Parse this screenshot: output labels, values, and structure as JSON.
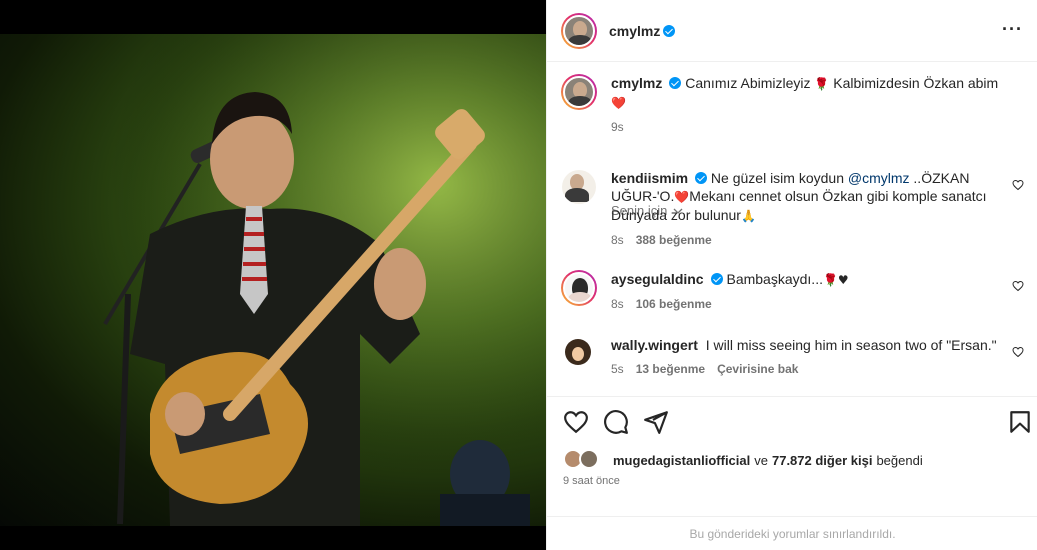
{
  "post": {
    "author": "cmylmz",
    "verified": true
  },
  "caption": {
    "username": "cmylmz",
    "text_before": "Canımız Abimizleyiz",
    "text_middle": "Kalbimizdesin Özkan abim",
    "time": "9s",
    "emoji_rose": "🌹",
    "emoji_heart": "❤️"
  },
  "sort": {
    "label": "Senin için"
  },
  "comments": [
    {
      "username": "kendiismim",
      "text_before": "Ne güzel isim koydun",
      "mention": "@cmylmz",
      "text_after": "..ÖZKAN UĞUR-'O.",
      "text_after2": "Mekanı cennet olsun Özkan gibi komple sanatcı Dünyada zor bulunur",
      "emoji_heart": "❤️",
      "emoji_pray": "🙏",
      "time": "8s",
      "likes": "388 beğenme"
    },
    {
      "username": "aysegulaldinc",
      "text": "Bambaşkaydı...",
      "emoji_tail": "🌹♥",
      "time": "8s",
      "likes": "106 beğenme"
    },
    {
      "username": "wally.wingert",
      "text": "I will miss seeing him in season two of \"Ersan.\"",
      "time": "5s",
      "likes": "13 beğenme",
      "translate": "Çevirisine bak"
    }
  ],
  "likes_summary": {
    "first_liker": "mugedagistanliofficial",
    "connector": "ve",
    "others": "77.872 diğer kişi",
    "suffix": "beğendi"
  },
  "posted_ago": "9 saat önce",
  "footer_note": "Bu gönderideki yorumlar sınırlandırıldı.",
  "colors": {
    "accent_blue": "#0095f6",
    "heart_red": "#ed4956",
    "muted_text": "#737373"
  },
  "icons": [
    "more-icon",
    "verified-icon",
    "heart-icon",
    "comment-icon",
    "share-icon",
    "bookmark-icon",
    "chevron-down-icon"
  ]
}
